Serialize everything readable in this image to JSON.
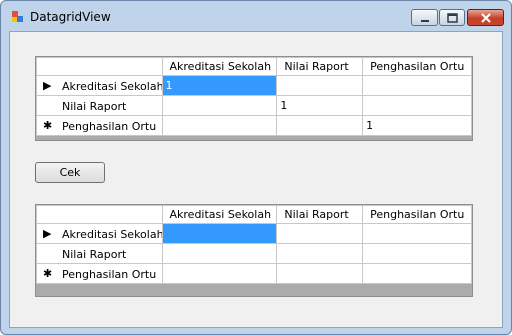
{
  "window": {
    "title": "DatagridView"
  },
  "button": {
    "cek": "Cek"
  },
  "grid1": {
    "columns": [
      "Akreditasi Sekolah",
      "Nilai Raport",
      "Penghasilan Ortu"
    ],
    "rows": [
      {
        "header": "Akreditasi Sekolah",
        "glyph": "▶",
        "cells": [
          "1",
          "",
          ""
        ]
      },
      {
        "header": "Nilai Raport",
        "glyph": "",
        "cells": [
          "",
          "1",
          ""
        ]
      },
      {
        "header": "Penghasilan Ortu",
        "glyph": "✱",
        "cells": [
          "",
          "",
          "1"
        ]
      }
    ]
  },
  "grid2": {
    "columns": [
      "Akreditasi Sekolah",
      "Nilai Raport",
      "Penghasilan Ortu"
    ],
    "rows": [
      {
        "header": "Akreditasi Sekolah",
        "glyph": "▶",
        "cells": [
          "",
          "",
          ""
        ]
      },
      {
        "header": "Nilai Raport",
        "glyph": "",
        "cells": [
          "",
          "",
          ""
        ]
      },
      {
        "header": "Penghasilan Ortu",
        "glyph": "✱",
        "cells": [
          "",
          "",
          ""
        ]
      }
    ]
  }
}
